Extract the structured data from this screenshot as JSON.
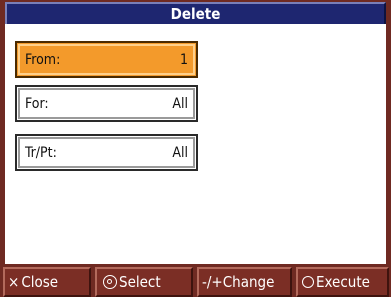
{
  "title": "Delete",
  "fields": [
    {
      "label": "From:",
      "value": "1",
      "selected": true
    },
    {
      "label": "For:",
      "value": "All",
      "selected": false
    },
    {
      "label": "Tr/Pt:",
      "value": "All",
      "selected": false
    }
  ],
  "function_bar": {
    "close": {
      "symbol": "×",
      "label": "Close"
    },
    "select": {
      "label": "Select"
    },
    "change": {
      "label": "-/+Change"
    },
    "execute": {
      "label": "Execute"
    }
  },
  "colors": {
    "title_bg": "#1e2670",
    "selected_field": "#f39a2b",
    "button_bg": "#7b2e25",
    "frame_bg": "#6f2a22"
  }
}
